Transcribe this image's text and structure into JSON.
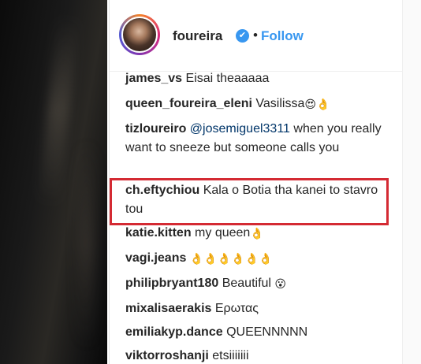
{
  "header": {
    "username": "foureira",
    "verified_icon": "✔",
    "separator": "•",
    "follow_label": "Follow"
  },
  "comments": [
    {
      "user": "james_vs",
      "text": "Eisai theaaaaa",
      "emoji": ""
    },
    {
      "user": "queen_foureira_eleni",
      "text": "Vasilissa",
      "emoji": "😍👌"
    },
    {
      "user": "tizloureiro",
      "mention": "@josemiguel3311",
      "text": "when you really want to sneeze but someone calls you",
      "emoji": ""
    },
    {
      "user": "ch.eftychiou",
      "text": "Kala o Botia tha kanei to stavro tou",
      "emoji": ""
    },
    {
      "user": "katie.kitten",
      "text": "my queen",
      "emoji": "👌"
    },
    {
      "user": "vagi.jeans",
      "text": "",
      "emoji": "👌👌👌👌👌👌"
    },
    {
      "user": "philipbryant180",
      "text": "Beautiful",
      "emoji": "😮"
    },
    {
      "user": "mixalisaerakis",
      "text": "Ερωτας",
      "emoji": ""
    },
    {
      "user": "emiliakyp.dance",
      "text": "QUEENNNNN",
      "emoji": ""
    },
    {
      "user": "viktorroshanji",
      "text": "etsiiiiiii",
      "emoji": ""
    }
  ],
  "colors": {
    "link_blue": "#3897f0",
    "highlight_red": "#d42a33",
    "text": "#262626"
  }
}
